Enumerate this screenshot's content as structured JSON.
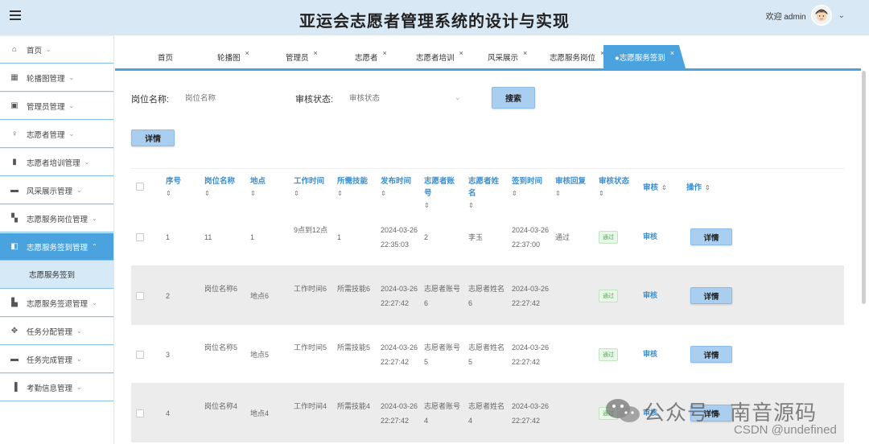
{
  "header": {
    "title": "亚运会志愿者管理系统的设计与实现",
    "welcome": "欢迎 admin",
    "chevron": "⌄"
  },
  "sidebar": {
    "items": [
      {
        "label": "首页",
        "icon": "home-icon"
      },
      {
        "label": "轮播图管理",
        "icon": "carousel-icon"
      },
      {
        "label": "管理员管理",
        "icon": "admin-icon"
      },
      {
        "label": "志愿者管理",
        "icon": "volunteer-icon"
      },
      {
        "label": "志愿者培训管理",
        "icon": "training-icon"
      },
      {
        "label": "风采展示管理",
        "icon": "showcase-icon"
      },
      {
        "label": "志愿服务岗位管理",
        "icon": "post-icon"
      },
      {
        "label": "志愿服务签到管理",
        "icon": "checkin-icon",
        "active": true
      },
      {
        "label": "志愿服务签退管理",
        "icon": "checkout-icon"
      },
      {
        "label": "任务分配管理",
        "icon": "task-assign-icon"
      },
      {
        "label": "任务完成管理",
        "icon": "task-done-icon"
      },
      {
        "label": "考勤信息管理",
        "icon": "attendance-icon"
      }
    ],
    "sub_item": "志愿服务签到"
  },
  "tabs": [
    {
      "label": "首页",
      "closable": false
    },
    {
      "label": "轮播图",
      "closable": true
    },
    {
      "label": "管理员",
      "closable": true
    },
    {
      "label": "志愿者",
      "closable": true
    },
    {
      "label": "志愿者培训",
      "closable": true
    },
    {
      "label": "风采展示",
      "closable": true
    },
    {
      "label": "志愿服务岗位",
      "closable": true
    },
    {
      "label": "●志愿服务签到",
      "closable": true,
      "active": true
    }
  ],
  "tab_close": "×",
  "search": {
    "post_label": "岗位名称:",
    "post_placeholder": "岗位名称",
    "status_label": "审核状态:",
    "status_placeholder": "审核状态",
    "search_button": "搜索",
    "detail_button": "详情"
  },
  "table": {
    "headers": {
      "index": "序号",
      "post": "岗位名称",
      "location": "地点",
      "work_time": "工作时间",
      "skills": "所需技能",
      "publish_time": "发布时间",
      "account": "志愿者账号",
      "name": "志愿者姓名",
      "checkin_time": "签到时间",
      "reply": "审核回复",
      "status": "审核状态",
      "audit": "审核",
      "action": "操作"
    },
    "sort_icon": "⇕",
    "rows": [
      {
        "index": "1",
        "post": "11",
        "location": "1",
        "work_time": "9点到12点",
        "skills": "1",
        "publish_time": "2024-03-26 22:35:03",
        "account": "2",
        "name": "李玉",
        "checkin_time": "2024-03-26 22:37:00",
        "reply": "通过",
        "status": "通过",
        "audit": "审核",
        "action": "详情"
      },
      {
        "index": "2",
        "post": "岗位名称6",
        "location": "地点6",
        "work_time": "工作时间6",
        "skills": "所需技能6",
        "publish_time": "2024-03-26 22:27:42",
        "account": "志愿者账号6",
        "name": "志愿者姓名6",
        "checkin_time": "2024-03-26 22:27:42",
        "reply": "",
        "status": "通过",
        "audit": "审核",
        "action": "详情"
      },
      {
        "index": "3",
        "post": "岗位名称5",
        "location": "地点5",
        "work_time": "工作时间5",
        "skills": "所需技能5",
        "publish_time": "2024-03-26 22:27:42",
        "account": "志愿者账号5",
        "name": "志愿者姓名5",
        "checkin_time": "2024-03-26 22:27:42",
        "reply": "",
        "status": "通过",
        "audit": "审核",
        "action": "详情"
      },
      {
        "index": "4",
        "post": "岗位名称4",
        "location": "地点4",
        "work_time": "工作时间4",
        "skills": "所需技能4",
        "publish_time": "2024-03-26 22:27:42",
        "account": "志愿者账号4",
        "name": "志愿者姓名4",
        "checkin_time": "2024-03-26 22:27:42",
        "reply": "",
        "status": "通过",
        "audit": "审核",
        "action": "详情"
      }
    ]
  },
  "watermark": {
    "main": "公众号 · 南音源码",
    "sub": "CSDN @undefined"
  },
  "colors": {
    "accent": "#4aa3df",
    "header_bg": "#d8e8f5",
    "button_bg": "#a9cef0",
    "header_text": "#3d8fd0",
    "success": "#4caf50"
  }
}
